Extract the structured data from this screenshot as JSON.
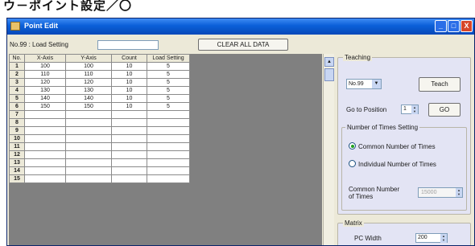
{
  "caption": "ウ－ポイント設定／〇",
  "window": {
    "title": "Point Edit",
    "min_glyph": "_",
    "max_glyph": "□",
    "close_glyph": "X"
  },
  "toolbar": {
    "load_label": "No.99 : Load Setting",
    "load_value": "",
    "clear_label": "CLEAR ALL DATA"
  },
  "grid": {
    "headers": [
      "No.",
      "X-Axis",
      "Y-Axis",
      "Count",
      "Load Setting"
    ],
    "rows": [
      [
        "1",
        "100",
        "100",
        "10",
        "5"
      ],
      [
        "2",
        "110",
        "110",
        "10",
        "5"
      ],
      [
        "3",
        "120",
        "120",
        "10",
        "5"
      ],
      [
        "4",
        "130",
        "130",
        "10",
        "5"
      ],
      [
        "5",
        "140",
        "140",
        "10",
        "5"
      ],
      [
        "6",
        "150",
        "150",
        "10",
        "5"
      ],
      [
        "7",
        "",
        "",
        "",
        ""
      ],
      [
        "8",
        "",
        "",
        "",
        ""
      ],
      [
        "9",
        "",
        "",
        "",
        ""
      ],
      [
        "10",
        "",
        "",
        "",
        ""
      ],
      [
        "11",
        "",
        "",
        "",
        ""
      ],
      [
        "12",
        "",
        "",
        "",
        ""
      ],
      [
        "13",
        "",
        "",
        "",
        ""
      ],
      [
        "14",
        "",
        "",
        "",
        ""
      ],
      [
        "15",
        "",
        "",
        "",
        ""
      ]
    ]
  },
  "teaching": {
    "label": "Teaching",
    "point_select": "No.99",
    "teach_button": "Teach",
    "goto_label": "Go to Position",
    "goto_value": "1",
    "go_button": "GO",
    "times_label": "Number of Times Setting",
    "option_common": "Common Number of Times",
    "option_individual": "Individual Number of Times",
    "common_count_label": "Common Number of Times",
    "common_count_value": "15000"
  },
  "matrix": {
    "label": "Matrix",
    "width_label": "PC Width",
    "width_value": "200"
  },
  "colors": {
    "titlebar": "#0a5fd8",
    "panel": "#e3e4f4",
    "grid_background": "#808080"
  }
}
